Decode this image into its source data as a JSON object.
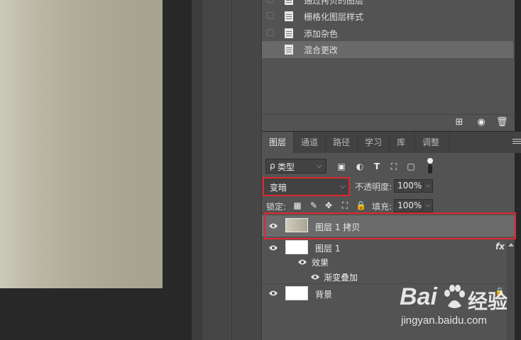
{
  "history": {
    "items": [
      {
        "label": "通过拷贝的图层"
      },
      {
        "label": "栅格化图层样式"
      },
      {
        "label": "添加杂色"
      },
      {
        "label": "混合更改",
        "selected": true
      }
    ],
    "buttons": [
      "new-snapshot-icon",
      "camera-icon",
      "trash-icon"
    ]
  },
  "layers_panel": {
    "tabs": [
      {
        "label": "图层",
        "active": true
      },
      {
        "label": "通道"
      },
      {
        "label": "路径"
      },
      {
        "label": "学习"
      },
      {
        "label": "库"
      },
      {
        "label": "调整"
      }
    ],
    "filter": {
      "kind_label": "类型",
      "search_glyph": "ρ"
    },
    "blend_mode": "变暗",
    "opacity_label": "不透明度:",
    "opacity_value": "100%",
    "lock_label": "锁定:",
    "fill_label": "填充:",
    "fill_value": "100%",
    "layers": [
      {
        "name": "图层 1 拷贝",
        "selected": true
      },
      {
        "name": "图层 1",
        "fx": "fx"
      },
      {
        "name": "效果",
        "effect": true
      },
      {
        "name": "渐变叠加",
        "effect": true
      },
      {
        "name": "背景",
        "locked": true
      }
    ]
  },
  "watermark": {
    "brand": "Bai",
    "brand2": "经验",
    "url": "jingyan.baidu.com"
  },
  "colors": {
    "highlight": "#e0262e",
    "panel_bg": "#535353",
    "selected_row": "#6b6b6b"
  }
}
